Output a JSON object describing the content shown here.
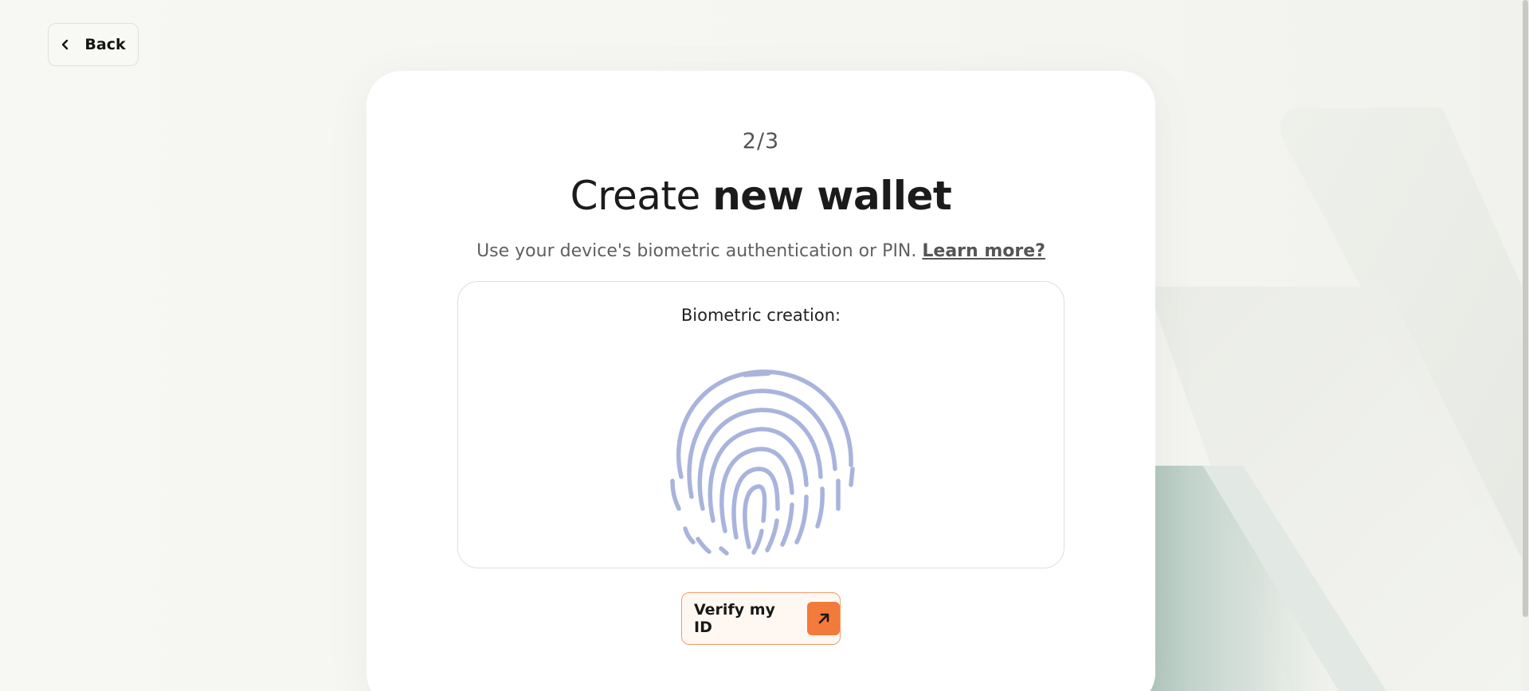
{
  "back_button": {
    "label": "Back",
    "icon": "chevron-left-icon"
  },
  "card": {
    "step": "2/3",
    "title_regular": "Create ",
    "title_bold": "new wallet",
    "subtitle_text": "Use your device's biometric authentication or PIN. ",
    "subtitle_link": "Learn more?",
    "biometric": {
      "label": "Biometric creation:",
      "icon": "fingerprint-icon"
    },
    "verify_button": {
      "label": "Verify my ID",
      "icon": "arrow-up-right-icon"
    }
  },
  "colors": {
    "accent": "#f27a3a",
    "fingerprint": "#a9b4dd",
    "background": "#f6f6f2"
  }
}
